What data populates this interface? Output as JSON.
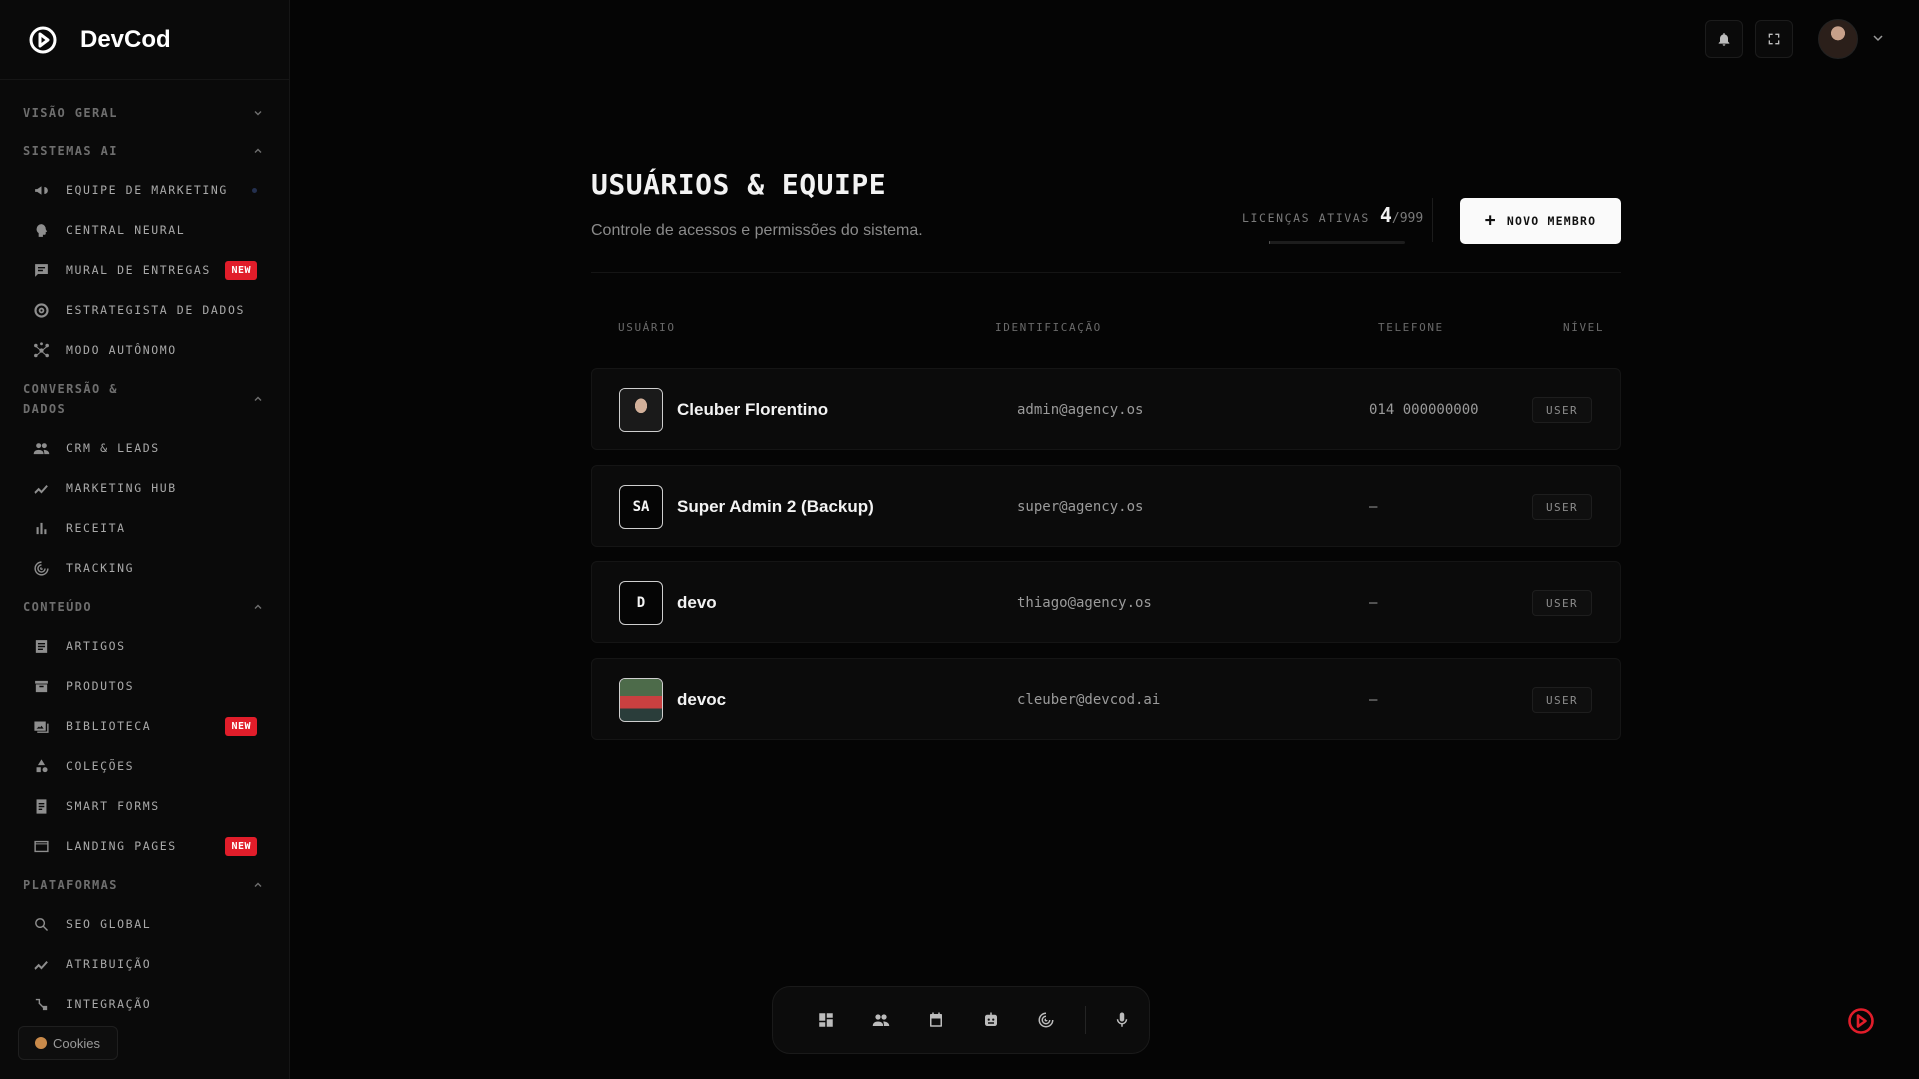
{
  "brand": {
    "name": "DevCod"
  },
  "sidebar": {
    "groups": [
      {
        "label": "VISÃO GERAL",
        "items": []
      },
      {
        "label": "SISTEMAS AI",
        "items": [
          {
            "label": "EQUIPE DE MARKETING",
            "icon": "megaphone-icon",
            "dot": true
          },
          {
            "label": "CENTRAL NEURAL",
            "icon": "brain-icon"
          },
          {
            "label": "MURAL DE ENTREGAS",
            "icon": "board-icon",
            "badge": "NEW"
          },
          {
            "label": "ESTRATEGISTA DE DADOS",
            "icon": "target-icon"
          },
          {
            "label": "MODO AUTÔNOMO",
            "icon": "hub-icon"
          }
        ]
      },
      {
        "label": "CONVERSÃO & DADOS",
        "items": [
          {
            "label": "CRM & LEADS",
            "icon": "people-icon"
          },
          {
            "label": "MARKETING HUB",
            "icon": "trend-icon"
          },
          {
            "label": "RECEITA",
            "icon": "bar-chart-icon"
          },
          {
            "label": "TRACKING",
            "icon": "radar-icon"
          }
        ]
      },
      {
        "label": "CONTEÚDO",
        "items": [
          {
            "label": "ARTIGOS",
            "icon": "article-icon"
          },
          {
            "label": "PRODUTOS",
            "icon": "box-icon"
          },
          {
            "label": "BIBLIOTECA",
            "icon": "images-icon",
            "badge": "NEW"
          },
          {
            "label": "COLEÇÕES",
            "icon": "shapes-icon"
          },
          {
            "label": "SMART FORMS",
            "icon": "form-icon"
          },
          {
            "label": "LANDING PAGES",
            "icon": "web-icon",
            "badge": "NEW"
          }
        ]
      },
      {
        "label": "PLATAFORMAS",
        "items": [
          {
            "label": "SEO GLOBAL",
            "icon": "search-icon"
          },
          {
            "label": "ATRIBUIÇÃO",
            "icon": "trend-icon"
          },
          {
            "label": "INTEGRAÇÃO",
            "icon": "integration-icon"
          }
        ]
      }
    ],
    "cookies_label": "Cookies"
  },
  "page": {
    "title": "USUÁRIOS & EQUIPE",
    "subtitle": "Controle de acessos e permissões do sistema.",
    "licenses_label": "LICENÇAS ATIVAS",
    "licenses_count": "4",
    "licenses_max": "/999",
    "licenses_fraction": 0.004,
    "new_member_label": "NOVO MEMBRO"
  },
  "table": {
    "headers": {
      "user": "USUÁRIO",
      "id": "IDENTIFICAÇÃO",
      "phone": "TELEFONE",
      "level": "NÍVEL"
    },
    "rows": [
      {
        "avatar": "",
        "avatar_type": "photo1",
        "name": "Cleuber Florentino",
        "email": "admin@agency.os",
        "phone": "014 000000000",
        "level": "USER"
      },
      {
        "avatar": "SA",
        "avatar_type": "initials",
        "name": "Super Admin 2 (Backup)",
        "email": "super@agency.os",
        "phone": "—",
        "level": "USER"
      },
      {
        "avatar": "D",
        "avatar_type": "initials",
        "name": "devo",
        "email": "thiago@agency.os",
        "phone": "—",
        "level": "USER"
      },
      {
        "avatar": "",
        "avatar_type": "photo2",
        "name": "devoc",
        "email": "cleuber@devcod.ai",
        "phone": "—",
        "level": "USER"
      }
    ]
  },
  "dock": [
    "grid-icon",
    "people-icon",
    "calendar-icon",
    "robot-icon",
    "radar-icon",
    "mic-icon"
  ],
  "colors": {
    "badge": "#e11d2a",
    "accent_logo": "#e11d2a",
    "background": "#050505"
  }
}
